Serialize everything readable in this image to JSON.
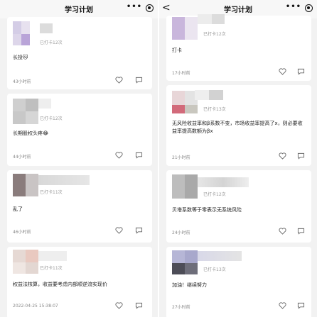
{
  "left": {
    "title": "学习计划",
    "more": "•••",
    "posts": [
      {
        "checkin": "已打卡12次",
        "content": "长投🐱",
        "time": "43小时前"
      },
      {
        "checkin": "已打卡12次",
        "content": "长期股权头疼😂",
        "time": "44小时前"
      },
      {
        "checkin": "已打卡11次",
        "content": "乱了",
        "time": "46小时前"
      },
      {
        "checkin": "已打卡11次",
        "content": "权益法核算，收益要考虑内部顺逆流实现价",
        "time": "2022-04-25 15:38:07"
      }
    ]
  },
  "right": {
    "title": "学习计划",
    "back": "<",
    "more": "•••",
    "posts": [
      {
        "checkin": "已打卡12次",
        "content": "打卡",
        "time": "17小时前"
      },
      {
        "checkin": "已打卡13次",
        "content": "无风险收益率和β系数不变，市场收益率提高了x，则必要收益率提高数额为βx",
        "time": "21小时前"
      },
      {
        "checkin": "已打卡12次",
        "content": "贝塔系数等于零表示无系统风险",
        "time": "24小时前"
      },
      {
        "checkin": "已打卡13次",
        "content": "加油！继续努力",
        "time": "27小时前"
      }
    ]
  },
  "colors": {
    "background": "#f2f2f2",
    "card": "#ffffff",
    "muted": "#999999"
  },
  "icons": {
    "like": "heart-outline-icon",
    "comment": "comment-outline-icon",
    "more": "more-dots-icon",
    "target": "target-icon",
    "back": "chevron-left-icon"
  }
}
